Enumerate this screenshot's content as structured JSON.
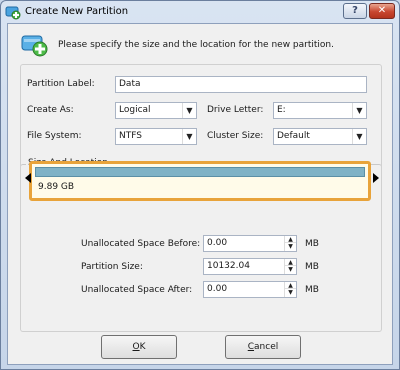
{
  "window": {
    "title": "Create New Partition",
    "help_label": "?",
    "close_label": "✕"
  },
  "intro_text": "Please specify the size and the location for the new partition.",
  "form": {
    "partition_label": {
      "label": "Partition Label:",
      "value": "Data"
    },
    "create_as": {
      "label": "Create As:",
      "value": "Logical"
    },
    "drive_letter": {
      "label": "Drive Letter:",
      "value": "E:"
    },
    "file_system": {
      "label": "File System:",
      "value": "NTFS"
    },
    "cluster_size": {
      "label": "Cluster Size:",
      "value": "Default"
    }
  },
  "size_location": {
    "title": "Size And Location",
    "disk_size": "9.89 GB",
    "fields": [
      {
        "label": "Unallocated Space Before:",
        "value": "0.00",
        "unit": "MB"
      },
      {
        "label": "Partition Size:",
        "value": "10132.04",
        "unit": "MB"
      },
      {
        "label": "Unallocated Space After:",
        "value": "0.00",
        "unit": "MB"
      }
    ]
  },
  "buttons": {
    "ok": {
      "mnemonic": "O",
      "rest": "K"
    },
    "cancel": {
      "mnemonic": "C",
      "rest": "ancel"
    }
  },
  "colors": {
    "accent_border": "#e8a33a",
    "disk_bar": "#7fb2c6",
    "close_red": "#c8462f"
  },
  "icons": {
    "title": "partition-wizard-icon",
    "wizard": "add-partition-icon",
    "dropdown": "chevron-down-icon",
    "spin_up": "spin-up-icon",
    "spin_down": "spin-down-icon"
  }
}
